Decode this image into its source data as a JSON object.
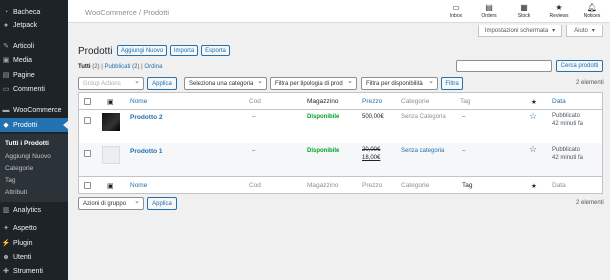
{
  "sidebar": {
    "items": [
      {
        "label": "Bacheca",
        "icon": "dashboard-icon"
      },
      {
        "label": "Jetpack",
        "icon": "jetpack-icon"
      },
      {
        "label": "Articoli",
        "icon": "pin-icon"
      },
      {
        "label": "Media",
        "icon": "media-icon"
      },
      {
        "label": "Pagine",
        "icon": "pages-icon"
      },
      {
        "label": "Commenti",
        "icon": "comments-icon"
      },
      {
        "label": "WooCommerce",
        "icon": "woocommerce-icon"
      },
      {
        "label": "Prodotti",
        "icon": "products-icon"
      },
      {
        "label": "Analytics",
        "icon": "analytics-icon"
      },
      {
        "label": "Aspetto",
        "icon": "appearance-icon"
      },
      {
        "label": "Plugin",
        "icon": "plugin-icon"
      },
      {
        "label": "Utenti",
        "icon": "users-icon"
      },
      {
        "label": "Strumenti",
        "icon": "tools-icon"
      }
    ],
    "submenu": [
      "Tutti i Prodotti",
      "Aggiungi Nuovo",
      "Categorie",
      "Tag",
      "Attributi"
    ]
  },
  "topbar": {
    "breadcrumb": "WooCommerce / Prodotti",
    "tools": [
      {
        "label": "Inbox",
        "icon": "inbox-icon"
      },
      {
        "label": "Orders",
        "icon": "orders-icon"
      },
      {
        "label": "Stock",
        "icon": "stock-icon"
      },
      {
        "label": "Reviews",
        "icon": "reviews-icon"
      },
      {
        "label": "Notices",
        "icon": "notices-icon"
      }
    ]
  },
  "screen_options": {
    "label": "Impostazioni schermata",
    "help": "Aiuto"
  },
  "page": {
    "title": "Prodotti",
    "add_new": "Aggiungi Nuovo",
    "import": "Importa",
    "export": "Esporta"
  },
  "views": {
    "all": "Tutti",
    "all_count": "(2)",
    "published": "Pubblicati",
    "published_count": "(2)",
    "sort": "Ordina"
  },
  "search": {
    "button": "Cerca prodotti",
    "placeholder": ""
  },
  "filters": {
    "bulk_top": "Group Actions",
    "apply": "Applica",
    "category": "Seleziona una categoria",
    "type": "Filtra per tipologia di prod",
    "stock": "Filtra per disponibilità",
    "filter_btn": "Filtra",
    "count_top": "2 elementi",
    "bulk_bottom": "Azioni di gruppo",
    "count_bottom": "2 elementi"
  },
  "table": {
    "headers": {
      "name": "Nome",
      "sku": "Cod",
      "stock": "Magazzino",
      "price": "Prezzo",
      "categories": "Categorie",
      "tags": "Tag",
      "date": "Data"
    },
    "footer_headers": {
      "name": "Nome",
      "sku": "Cod",
      "stock": "Magazzino",
      "price": "Prezzo",
      "categories": "Categorie",
      "tags": "Tag",
      "date": "Data"
    },
    "rows": [
      {
        "name": "Prodotto 2",
        "sku": "–",
        "stock": "Disponibile",
        "price": "500,00€",
        "sale_price": "",
        "categories": "Senza Categoria",
        "tags": "–",
        "date_status": "Pubblicato",
        "date": "42 minuti fa"
      },
      {
        "name": "Prodotto 1",
        "sku": "–",
        "stock": "Disponibile",
        "price": "20,00€",
        "sale_price": "18,00€",
        "categories": "Senza categoria",
        "tags": "–",
        "date_status": "Pubblicato",
        "date": "42 minuti fa"
      }
    ]
  },
  "colors": {
    "accent": "#2271b1",
    "sidebar": "#1d2327",
    "instock": "#00a32a"
  }
}
